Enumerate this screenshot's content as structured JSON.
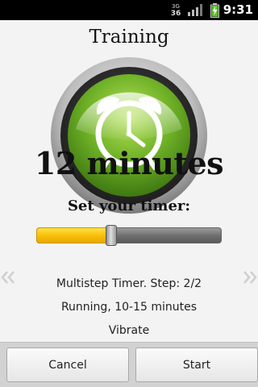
{
  "status_bar": {
    "time": "9:31",
    "network_badge_top": "3G",
    "network_badge_bottom": "36",
    "icons": [
      "network-type-icon",
      "signal-icon",
      "battery-charging-icon"
    ]
  },
  "screen": {
    "title": "Training",
    "duration": "12 minutes",
    "set_label": "Set your timer:",
    "slider": {
      "level": 0.405,
      "fill_color": "#f7bd06",
      "track_color": "#6d6d6d"
    },
    "logo_icon": "alarm-clock-icon",
    "pager": {
      "left_icon": "chevron-double-left-icon",
      "right_icon": "chevron-double-right-icon"
    },
    "info": {
      "step": "Multistep Timer. Step: 2/2",
      "running": "Running, 10-15 minutes",
      "vibrate": "Vibrate"
    }
  },
  "buttons": {
    "cancel": "Cancel",
    "start": "Start"
  },
  "colors": {
    "accent_green": "#6db026",
    "slider_yellow": "#f7bd06"
  }
}
